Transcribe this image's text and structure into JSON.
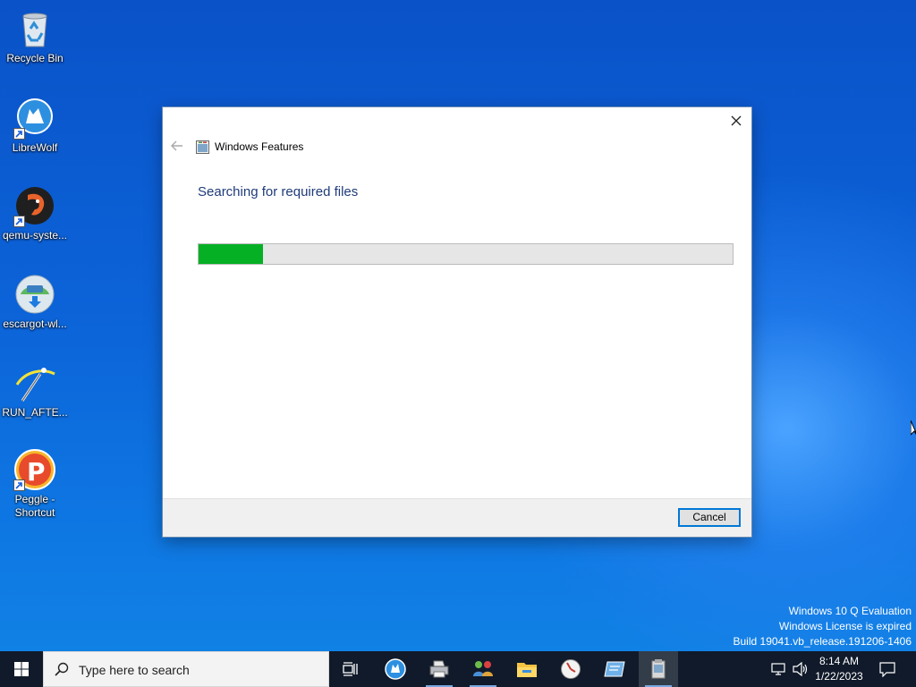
{
  "desktop": {
    "icons": [
      {
        "label": "Recycle Bin",
        "icon": "recycle-bin-icon"
      },
      {
        "label": "LibreWolf",
        "icon": "librewolf-icon"
      },
      {
        "label": "qemu-syste...",
        "icon": "qemu-icon"
      },
      {
        "label": "escargot-wl...",
        "icon": "escargot-icon"
      },
      {
        "label": "RUN_AFTE...",
        "icon": "run-after-icon"
      },
      {
        "label": "Peggle - Shortcut",
        "icon": "peggle-icon"
      }
    ]
  },
  "dialog": {
    "title": "Windows Features",
    "heading": "Searching for required files",
    "progress": 0.12,
    "progress_color": "#06b025",
    "cancel_label": "Cancel"
  },
  "watermark": {
    "line1": "Windows 10 Q Evaluation",
    "line2": "Windows License is expired",
    "line3": "Build 19041.vb_release.191206-1406"
  },
  "taskbar": {
    "search_placeholder": "Type here to search",
    "apps": [
      "task-view-icon",
      "librewolf-taskbar-icon",
      "printer-app-icon",
      "network-people-icon",
      "file-explorer-icon",
      "app-clock-icon",
      "window-app-icon",
      "windows-features-app-icon"
    ],
    "time": "8:14 AM",
    "date": "1/22/2023"
  },
  "colors": {
    "accent": "#0078d7",
    "taskbar": "#101a2a"
  }
}
